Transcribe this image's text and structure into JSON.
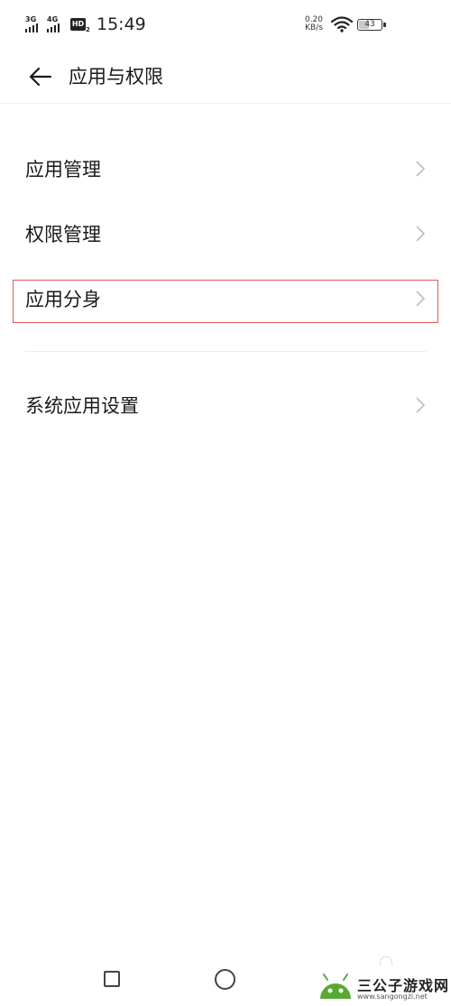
{
  "status_bar": {
    "net1": "3G",
    "net2": "4G",
    "hd": "HD",
    "hd_sub": "2",
    "time": "15:49",
    "net_speed_value": "0.20",
    "net_speed_unit": "KB/s",
    "battery": "43"
  },
  "header": {
    "title": "应用与权限",
    "back_icon": "arrow-left-icon"
  },
  "menu": {
    "items": [
      {
        "label": "应用管理"
      },
      {
        "label": "权限管理"
      },
      {
        "label": "应用分身",
        "highlighted": true
      },
      {
        "label": "系统应用设置"
      }
    ],
    "highlight_color": "#e15a5a"
  },
  "nav_bar": {
    "recent_icon": "square-icon",
    "home_icon": "circle-icon"
  },
  "watermark": {
    "name": "三公子游戏网",
    "url": "www.sangongzi.net"
  }
}
